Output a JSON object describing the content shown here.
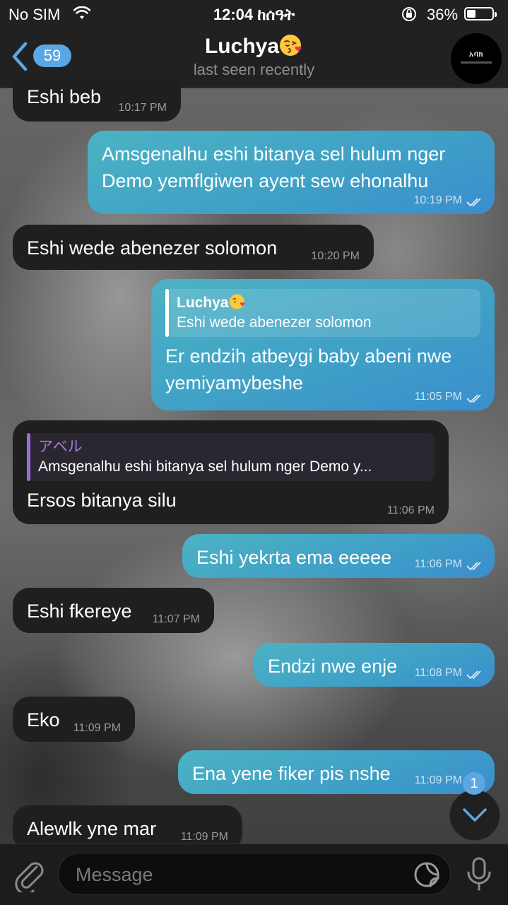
{
  "status_bar": {
    "carrier": "No SIM",
    "time": "12:04 ከሰዓት",
    "battery_percent": "36%",
    "battery_level": 0.36,
    "icons": [
      "wifi-icon",
      "orientation-lock-icon",
      "battery-icon"
    ]
  },
  "header": {
    "back_badge": "59",
    "contact_name": "Luchya",
    "contact_emoji": "face-blowing-kiss-emoji",
    "status": "last seen recently",
    "avatar_text": "አባክ"
  },
  "messages": [
    {
      "direction": "in",
      "text": "Eshi beb",
      "time": "10:17 PM"
    },
    {
      "direction": "out",
      "text_lines": [
        "Amsgenalhu eshi bitanya sel hulum nger",
        "Demo yemflgiwen ayent sew ehonalhu"
      ],
      "time": "10:19 PM",
      "read": true
    },
    {
      "direction": "in",
      "text": "Eshi wede abenezer solomon",
      "time": "10:20 PM"
    },
    {
      "direction": "out",
      "reply": {
        "name": "Luchya",
        "text": "Eshi wede abenezer solomon"
      },
      "text_lines": [
        "Er endzih atbeygi baby abeni nwe",
        "yemiyamybeshe"
      ],
      "time": "11:05 PM",
      "read": true
    },
    {
      "direction": "in",
      "reply": {
        "name": "アベル",
        "text": "Amsgenalhu eshi bitanya sel hulum nger Demo y..."
      },
      "text": "Ersos bitanya silu",
      "time": "11:06 PM"
    },
    {
      "direction": "out",
      "text": "Eshi yekrta ema eeeee",
      "time": "11:06 PM",
      "read": true
    },
    {
      "direction": "in",
      "text": "Eshi fkereye",
      "time": "11:07 PM"
    },
    {
      "direction": "out",
      "text": "Endzi nwe enje",
      "time": "11:08 PM",
      "read": true
    },
    {
      "direction": "in",
      "text": "Eko",
      "time": "11:09 PM"
    },
    {
      "direction": "out",
      "text": "Ena yene fiker pis nshe",
      "time": "11:09 PM",
      "read": true
    },
    {
      "direction": "in",
      "text": "Alewlk yne mar",
      "time": "11:09 PM"
    }
  ],
  "scroll_down": {
    "badge": "1"
  },
  "input_bar": {
    "placeholder": "Message"
  },
  "colors": {
    "accent": "#5aa7e3",
    "outgoing_bubble": "#3f9fc6",
    "incoming_bubble": "#1f1f1f",
    "reply_accent": "#9b6cd9"
  }
}
